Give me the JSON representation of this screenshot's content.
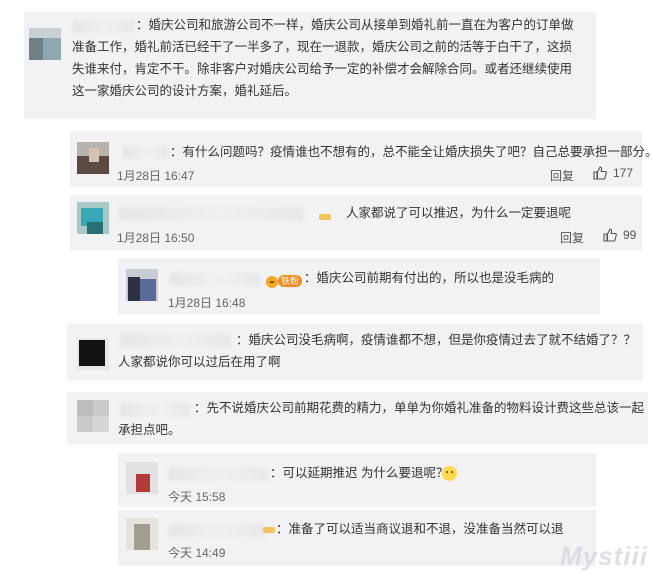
{
  "comments": [
    {
      "text": "：婚庆公司和旅游公司不一样，婚庆公司从接单到婚礼前一直在为客户的订单做准备工作，婚礼前活已经干了一半多了，现在一退款，婚庆公司之前的活等于白干了，这损失谁来付，肯定不干。除非客户对婚庆公司给予一定的补偿才会解除合同。或者还继续使用这一家婚庆公司的设计方案，婚礼延后。"
    },
    {
      "text": "：有什么问题吗？疫情谁也不想有的，总不能全让婚庆损失了吧？自己总要承担一部分。",
      "time": "1月28日 16:47",
      "reply_label": "回复",
      "likes": "177"
    },
    {
      "text": "人家都说了可以推迟，为什么一定要退呢",
      "time": "1月28日 16:50",
      "reply_label": "回复",
      "likes": "99"
    },
    {
      "badge": "铁粉",
      "text": "：婚庆公司前期有付出的，所以也是没毛病的",
      "time": "1月28日 16:48"
    },
    {
      "text": "：婚庆公司没毛病啊，疫情谁都不想，但是你疫情过去了就不结婚了？？人家都说你可以过后在用了啊"
    },
    {
      "text": "：先不说婚庆公司前期花费的精力，单单为你婚礼准备的物料设计费这些总该一起承担点吧。"
    },
    {
      "text": "：可以延期推迟 为什么要退呢？",
      "time": "今天 15:58"
    },
    {
      "text": "：准备了可以适当商议退和不退，没准备当然可以退",
      "time": "今天 14:49"
    }
  ],
  "icons": {
    "like": "thumbs-up-icon",
    "medal": "medal-icon",
    "emoji": "doge-emoji-icon"
  },
  "watermark": "Mystiii"
}
